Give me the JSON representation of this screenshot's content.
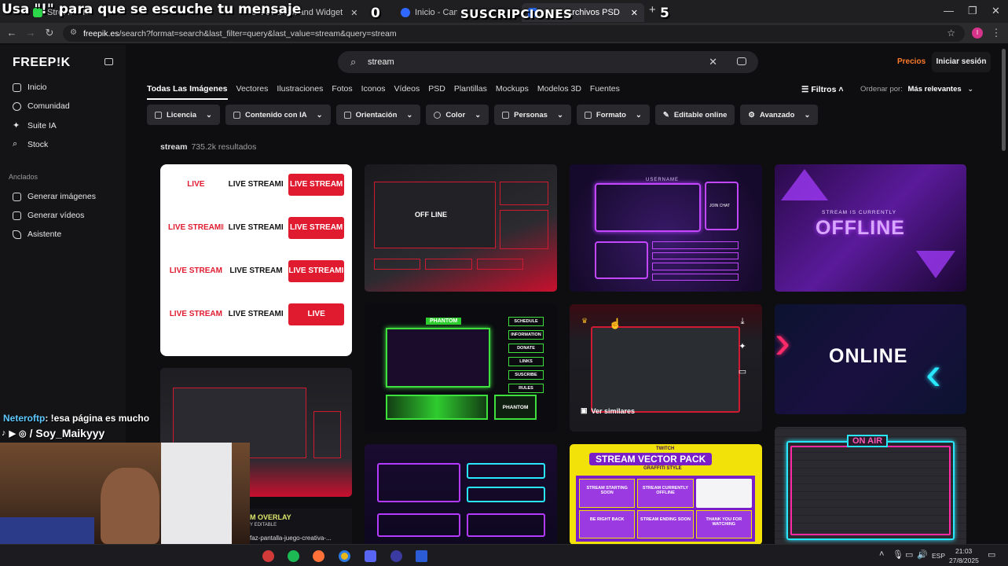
{
  "overlay": {
    "top_caption": "Usa \"!\" para que se escuche tu mensaje",
    "count_left": "0",
    "subs_label": "SUSCRIPCIONES",
    "count_right": "5",
    "chat_user": "Neteroftp",
    "chat_message": ": !esa página es mucho",
    "socials_handle": "/ Soy_Maikyyy"
  },
  "browser": {
    "tabs": [
      {
        "label": "Stream - Ki",
        "active": false
      },
      {
        "label": "est ChatBot and Widget",
        "active": false
      },
      {
        "label": "Inicio - Canva",
        "active": false
      },
      {
        "label": "archivos PSD",
        "active": true
      }
    ],
    "new_tab": "+",
    "url_host": "freepik.es",
    "url_path": "/search?format=search&last_filter=query&last_value=stream&query=stream",
    "profile_initial": "I"
  },
  "sidebar": {
    "logo": "FREEP!K",
    "items": [
      {
        "label": "Inicio",
        "icon": "home-icon"
      },
      {
        "label": "Comunidad",
        "icon": "globe-icon"
      },
      {
        "label": "Suite IA",
        "icon": "sparkle-icon"
      },
      {
        "label": "Stock",
        "icon": "search-icon"
      }
    ],
    "pinned_heading": "Anclados",
    "pinned": [
      {
        "label": "Generar imágenes",
        "icon": "image-icon"
      },
      {
        "label": "Generar vídeos",
        "icon": "video-icon"
      },
      {
        "label": "Asistente",
        "icon": "assistant-icon"
      }
    ]
  },
  "search": {
    "value": "stream"
  },
  "header": {
    "pricing": "Precios",
    "login": "Iniciar sesión"
  },
  "categories": [
    "Todas Las Imágenes",
    "Vectores",
    "Ilustraciones",
    "Fotos",
    "Iconos",
    "Vídeos",
    "PSD",
    "Plantillas",
    "Mockups",
    "Modelos 3D",
    "Fuentes"
  ],
  "active_category": 0,
  "toolbar": {
    "filters_label": "Filtros",
    "sort_prefix": "Ordenar por:",
    "sort_value": "Más relevantes"
  },
  "filters": [
    {
      "label": "Licencia",
      "dropdown": true
    },
    {
      "label": "Contenido con IA",
      "dropdown": true
    },
    {
      "label": "Orientación",
      "dropdown": true
    },
    {
      "label": "Color",
      "dropdown": true
    },
    {
      "label": "Personas",
      "dropdown": true
    },
    {
      "label": "Formato",
      "dropdown": true
    },
    {
      "label": "Editable online",
      "dropdown": false
    },
    {
      "label": "Avanzado",
      "dropdown": true
    }
  ],
  "results": {
    "query": "stream",
    "count": "735.2k resultados"
  },
  "thumbs": {
    "t1_labels": [
      "LIVE",
      "LIVE STREAMING",
      "LIVE STREAM",
      "LIVE STREAMING",
      "LIVE STREAMING",
      "LIVE STREAM",
      "LIVE STREAM",
      "LIVE STREAM",
      "LIVE STREAMING",
      "LIVE STREAM",
      "LIVE STREAMING",
      "LIVE"
    ],
    "t2_label": "OFF LINE",
    "t3_label": "USERNAME",
    "t3_chat": "JOIN CHAT",
    "t4_sub": "STREAM IS CURRENTLY",
    "t4_label": "OFFLINE",
    "t6_label": "PHANTOM",
    "t6_menu": [
      "SCHEDULE",
      "INFORMATION",
      "DONATE",
      "LINKS",
      "SUSCRIBE",
      "RULES"
    ],
    "t7_hover": "Ver similares",
    "t8_label": "ONLINE",
    "t10_title": "STREAM VECTOR PACK",
    "t10_top": "TWITCH",
    "t10_sub": "GRAFFITI STYLE",
    "t10_cards": [
      "STREAM STARTING SOON",
      "STREAM CURRENTLY OFFLINE",
      "BE RIGHT BACK",
      "STREAM ENDING SOON",
      "THANK YOU FOR WATCHING"
    ],
    "t11_label": "ON AIR",
    "t12_label": "M OVERLAY",
    "t12_sub": "Y EDITABLE"
  },
  "download_label": "faz-pantalla-juego-creativa-...",
  "taskbar": {
    "lang": "ESP",
    "time": "21:03",
    "date": "27/8/2025"
  }
}
